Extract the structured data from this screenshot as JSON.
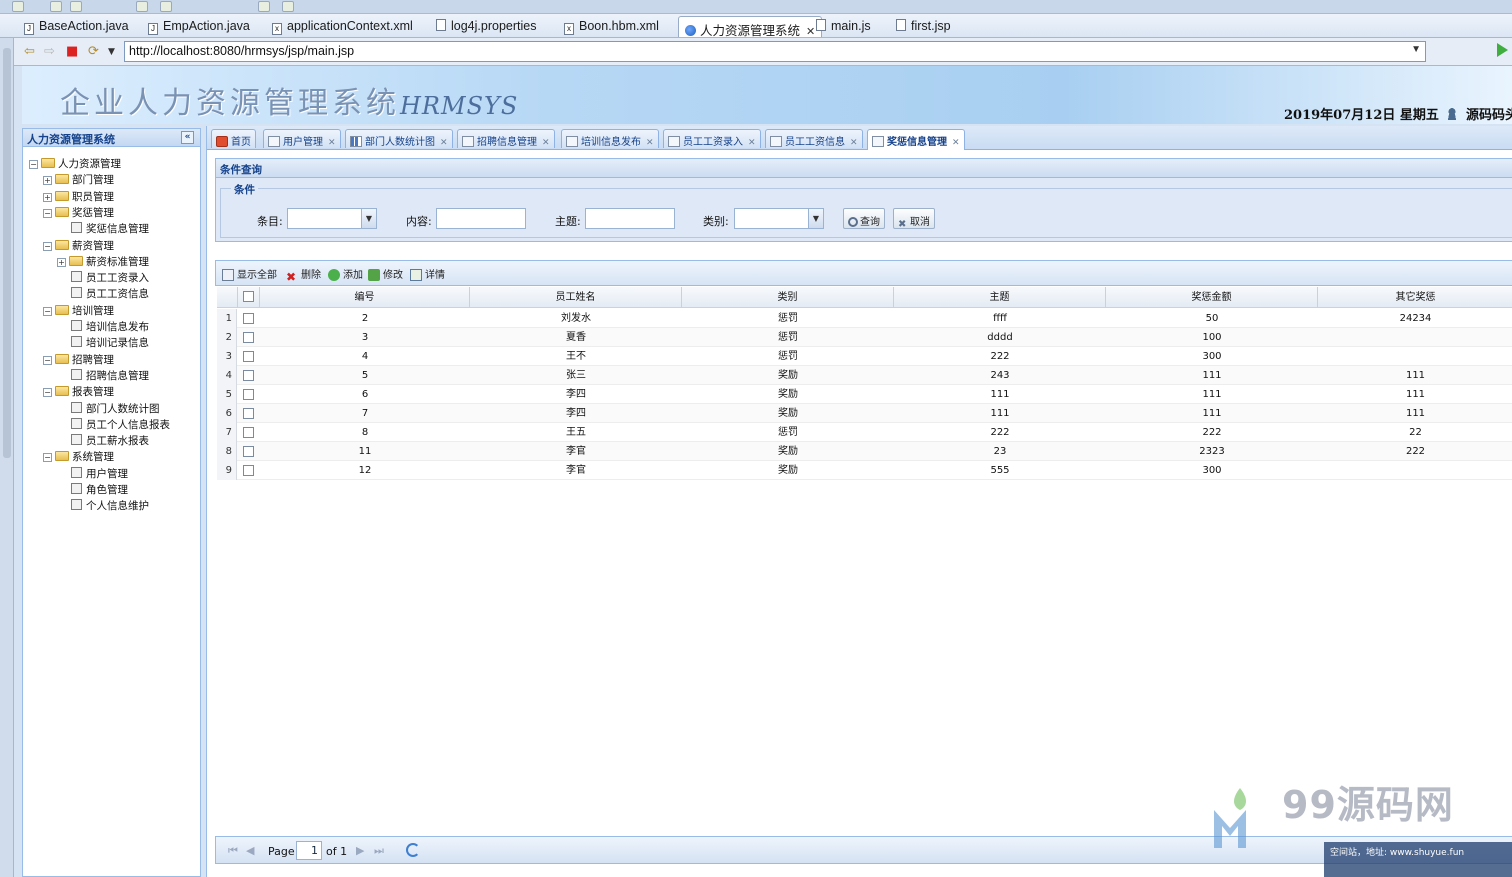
{
  "editor_tabs": [
    {
      "label": "BaseAction.java",
      "icon": "java-file-icon",
      "active": false
    },
    {
      "label": "EmpAction.java",
      "icon": "java-file-icon",
      "active": false
    },
    {
      "label": "applicationContext.xml",
      "icon": "xml-file-icon",
      "active": false
    },
    {
      "label": "log4j.properties",
      "icon": "properties-file-icon",
      "active": false
    },
    {
      "label": "Boon.hbm.xml",
      "icon": "xml-file-icon",
      "active": false
    },
    {
      "label": "人力资源管理系统",
      "icon": "globe-icon",
      "active": true
    },
    {
      "label": "main.js",
      "icon": "js-file-icon",
      "active": false
    },
    {
      "label": "first.jsp",
      "icon": "jsp-file-icon",
      "active": false
    }
  ],
  "browser": {
    "url": "http://localhost:8080/hrmsys/jsp/main.jsp"
  },
  "header": {
    "title": "企业人力资源管理系统",
    "subtitle": "HRMSYS",
    "date": "2019年07月12日 星期五",
    "user": "源码码头"
  },
  "menu": {
    "title": "人力资源管理系统",
    "items": [
      {
        "label": "人力资源管理",
        "kind": "folder",
        "toggle": "−"
      },
      {
        "label": "部门管理",
        "kind": "folder",
        "toggle": "+"
      },
      {
        "label": "职员管理",
        "kind": "folder",
        "toggle": "+"
      },
      {
        "label": "奖惩管理",
        "kind": "folder",
        "toggle": "−"
      },
      {
        "label": "奖惩信息管理",
        "kind": "leaf",
        "toggle": ""
      },
      {
        "label": "薪资管理",
        "kind": "folder",
        "toggle": "−"
      },
      {
        "label": "薪资标准管理",
        "kind": "folder",
        "toggle": "+"
      },
      {
        "label": "员工工资录入",
        "kind": "leaf",
        "toggle": ""
      },
      {
        "label": "员工工资信息",
        "kind": "leaf",
        "toggle": ""
      },
      {
        "label": "培训管理",
        "kind": "folder",
        "toggle": "−"
      },
      {
        "label": "培训信息发布",
        "kind": "leaf",
        "toggle": ""
      },
      {
        "label": "培训记录信息",
        "kind": "leaf",
        "toggle": ""
      },
      {
        "label": "招聘管理",
        "kind": "folder",
        "toggle": "−"
      },
      {
        "label": "招聘信息管理",
        "kind": "leaf",
        "toggle": ""
      },
      {
        "label": "报表管理",
        "kind": "folder",
        "toggle": "−"
      },
      {
        "label": "部门人数统计图",
        "kind": "leaf",
        "toggle": ""
      },
      {
        "label": "员工个人信息报表",
        "kind": "leaf",
        "toggle": ""
      },
      {
        "label": "员工薪水报表",
        "kind": "leaf",
        "toggle": ""
      },
      {
        "label": "系统管理",
        "kind": "folder",
        "toggle": "−"
      },
      {
        "label": "用户管理",
        "kind": "leaf",
        "toggle": ""
      },
      {
        "label": "角色管理",
        "kind": "leaf",
        "toggle": ""
      },
      {
        "label": "个人信息维护",
        "kind": "leaf",
        "toggle": ""
      }
    ]
  },
  "app_tabs": [
    {
      "label": "首页",
      "closable": false,
      "active": false
    },
    {
      "label": "用户管理",
      "closable": true,
      "active": false
    },
    {
      "label": "部门人数统计图",
      "closable": true,
      "active": false
    },
    {
      "label": "招聘信息管理",
      "closable": true,
      "active": false
    },
    {
      "label": "培训信息发布",
      "closable": true,
      "active": false
    },
    {
      "label": "员工工资录入",
      "closable": true,
      "active": false
    },
    {
      "label": "员工工资信息",
      "closable": true,
      "active": false
    },
    {
      "label": "奖惩信息管理",
      "closable": true,
      "active": true
    }
  ],
  "search": {
    "panel_title": "条件查询",
    "legend": "条件",
    "item_label": "条目:",
    "content_label": "内容:",
    "subject_label": "主题:",
    "category_label": "类别:",
    "query_button": "查询",
    "cancel_button": "取消"
  },
  "toolbar": {
    "show_all": "显示全部",
    "delete": "删除",
    "add": "添加",
    "edit": "修改",
    "detail": "详情"
  },
  "grid": {
    "columns": [
      "编号",
      "员工姓名",
      "类别",
      "主题",
      "奖惩金额",
      "其它奖惩"
    ],
    "rows": [
      {
        "num": "1",
        "id": "2",
        "name": "刘发水",
        "category": "惩罚",
        "subject": "ffff",
        "amount": "50",
        "other": "24234"
      },
      {
        "num": "2",
        "id": "3",
        "name": "夏香",
        "category": "惩罚",
        "subject": "dddd",
        "amount": "100",
        "other": ""
      },
      {
        "num": "3",
        "id": "4",
        "name": "王不",
        "category": "惩罚",
        "subject": "222",
        "amount": "300",
        "other": ""
      },
      {
        "num": "4",
        "id": "5",
        "name": "张三",
        "category": "奖励",
        "subject": "243",
        "amount": "111",
        "other": "111"
      },
      {
        "num": "5",
        "id": "6",
        "name": "李四",
        "category": "奖励",
        "subject": "111",
        "amount": "111",
        "other": "111"
      },
      {
        "num": "6",
        "id": "7",
        "name": "李四",
        "category": "奖励",
        "subject": "111",
        "amount": "111",
        "other": "111"
      },
      {
        "num": "7",
        "id": "8",
        "name": "王五",
        "category": "惩罚",
        "subject": "222",
        "amount": "222",
        "other": "22"
      },
      {
        "num": "8",
        "id": "11",
        "name": "李官",
        "category": "奖励",
        "subject": "23",
        "amount": "2323",
        "other": "222"
      },
      {
        "num": "9",
        "id": "12",
        "name": "李官",
        "category": "奖励",
        "subject": "555",
        "amount": "300",
        "other": ""
      }
    ]
  },
  "pager": {
    "page_label": "Page",
    "page_value": "1",
    "of_label": "of 1"
  },
  "watermark": {
    "brand": "99源码网",
    "note": "空间站，地址: www.shuyue.fun"
  }
}
